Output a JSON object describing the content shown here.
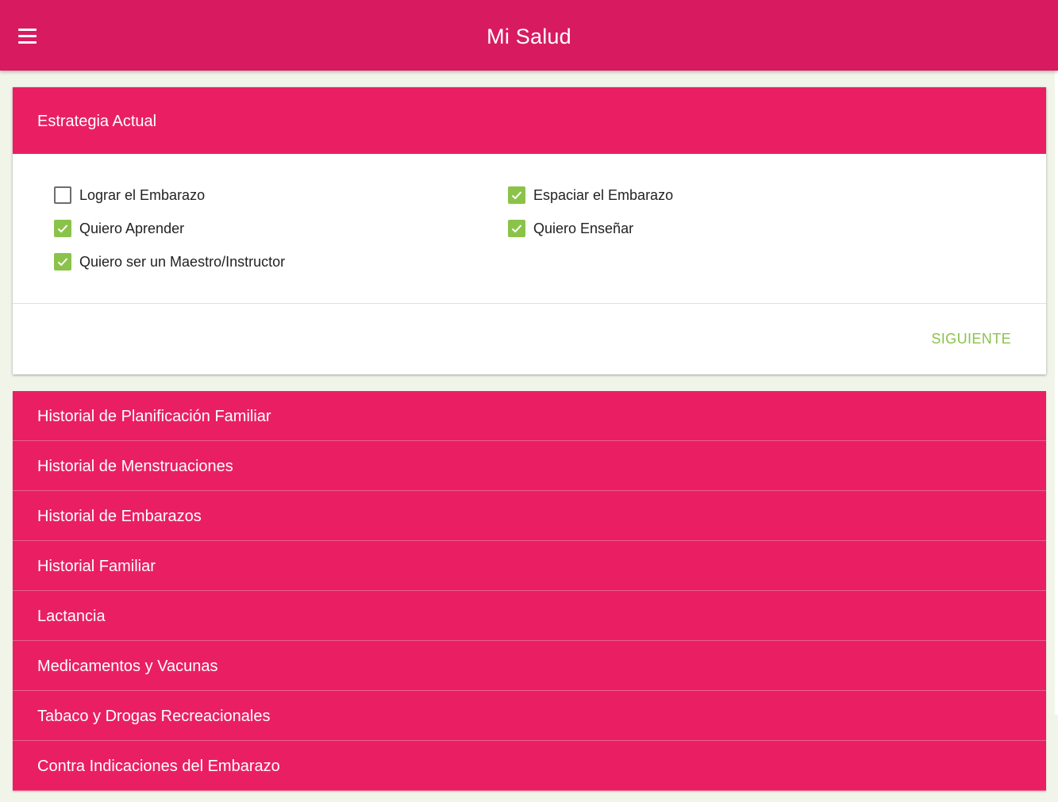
{
  "app_bar": {
    "title": "Mi Salud",
    "menu_icon": "hamburger-menu-icon"
  },
  "strategy_card": {
    "header": "Estrategia Actual",
    "options": [
      {
        "label": "Lograr el Embarazo",
        "checked": false
      },
      {
        "label": "Espaciar el Embarazo",
        "checked": true
      },
      {
        "label": "Quiero Aprender",
        "checked": true
      },
      {
        "label": "Quiero Enseñar",
        "checked": true
      },
      {
        "label": "Quiero ser un Maestro/Instructor",
        "checked": true
      }
    ],
    "next_label": "SIGUIENTE"
  },
  "sections": [
    "Historial de Planificación Familiar",
    "Historial de Menstruaciones",
    "Historial de Embarazos",
    "Historial Familiar",
    "Lactancia",
    "Medicamentos y Vacunas",
    "Tabaco y Drogas Recreacionales",
    "Contra Indicaciones del Embarazo"
  ],
  "colors": {
    "app_bar": "#d81b60",
    "accent": "#ea1f63",
    "checkbox_checked": "#8bc34a",
    "next_button": "#8bc34a",
    "background": "#f1f5e9"
  }
}
